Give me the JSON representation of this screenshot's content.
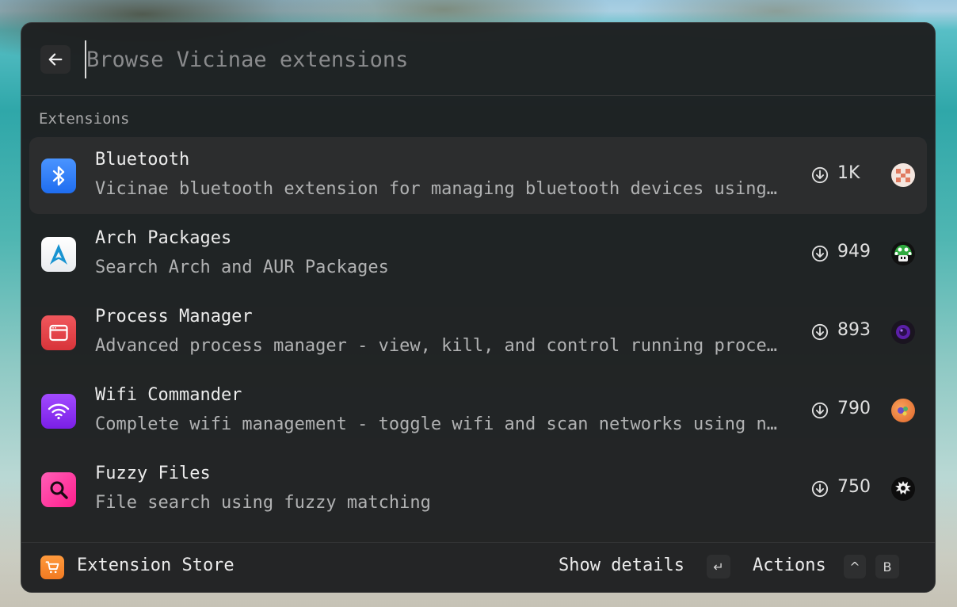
{
  "search": {
    "placeholder": "Browse Vicinae extensions",
    "value": ""
  },
  "section": {
    "label": "Extensions"
  },
  "extensions": [
    {
      "title": "Bluetooth",
      "subtitle": "Vicinae bluetooth extension for managing bluetooth devices using bluetoothctl",
      "downloads": "1K",
      "icon": "bluetooth-icon",
      "selected": true
    },
    {
      "title": "Arch Packages",
      "subtitle": "Search Arch and AUR Packages",
      "downloads": "949",
      "icon": "arch-linux-icon",
      "selected": false
    },
    {
      "title": "Process Manager",
      "subtitle": "Advanced process manager - view, kill, and control running processes",
      "downloads": "893",
      "icon": "app-window-icon",
      "selected": false
    },
    {
      "title": "Wifi Commander",
      "subtitle": "Complete wifi management - toggle wifi and scan networks using nmcli",
      "downloads": "790",
      "icon": "wifi-icon",
      "selected": false
    },
    {
      "title": "Fuzzy Files",
      "subtitle": "File search using fuzzy matching",
      "downloads": "750",
      "icon": "magnifier-icon",
      "selected": false
    }
  ],
  "footer": {
    "store_label": "Extension Store",
    "primary_action": "Show details",
    "primary_key": "↵",
    "actions_label": "Actions",
    "actions_modifier": "^",
    "actions_key": "B"
  },
  "colors": {
    "window_bg": "#1e1f20",
    "selected_row": "#2c2d2e",
    "bluetooth": "#2f7cf6",
    "arch": "#1793d1",
    "process_manager": "#e5484d",
    "wifi": "#8b2cf5",
    "fuzzy_files": "#ff2d9a",
    "store": "#f27a22"
  }
}
